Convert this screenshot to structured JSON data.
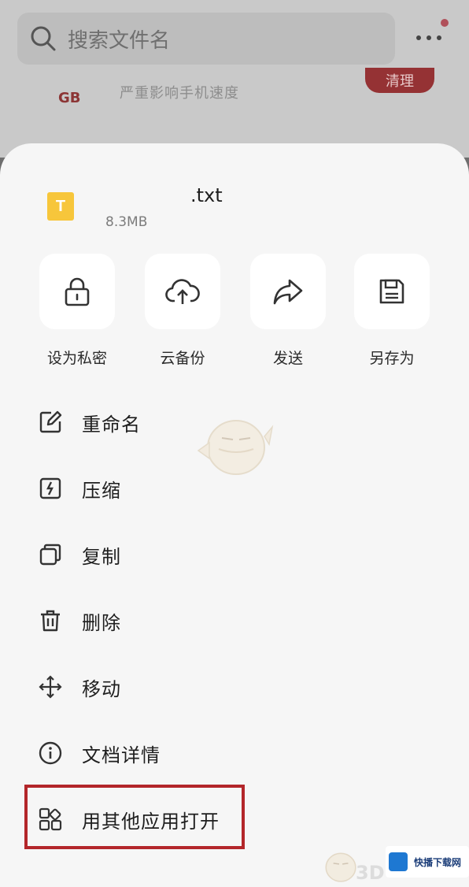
{
  "background": {
    "search_placeholder": "搜索文件名",
    "storage_unit": "GB",
    "storage_hint": "严重影响手机速度",
    "clean_button": "清理"
  },
  "file": {
    "type_letter": "T",
    "name": ".txt",
    "size": "8.3MB"
  },
  "actions": [
    {
      "label": "设为私密",
      "icon": "lock-icon"
    },
    {
      "label": "云备份",
      "icon": "cloud-upload-icon"
    },
    {
      "label": "发送",
      "icon": "share-arrow-icon"
    },
    {
      "label": "另存为",
      "icon": "save-icon"
    }
  ],
  "menu": [
    {
      "label": "重命名",
      "icon": "edit-icon"
    },
    {
      "label": "压缩",
      "icon": "zip-icon"
    },
    {
      "label": "复制",
      "icon": "copy-icon"
    },
    {
      "label": "删除",
      "icon": "trash-icon"
    },
    {
      "label": "移动",
      "icon": "move-icon"
    },
    {
      "label": "文档详情",
      "icon": "info-icon"
    },
    {
      "label": "用其他应用打开",
      "icon": "apps-grid-icon",
      "highlighted": true
    }
  ],
  "watermark": {
    "site_name": "快播下载网",
    "brand": "3D"
  },
  "colors": {
    "highlight_border": "#b3262a",
    "file_icon": "#f7c63b",
    "accent_red": "#953234"
  }
}
